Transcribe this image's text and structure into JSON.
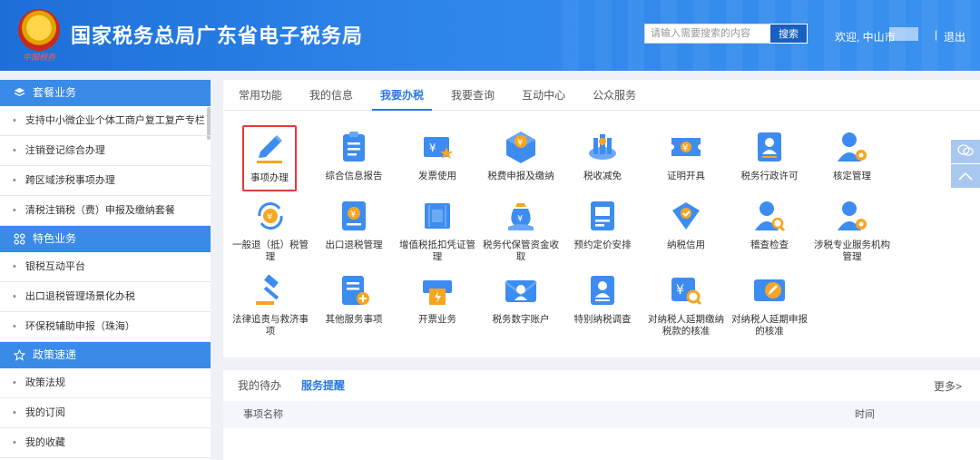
{
  "header": {
    "emblem_caption": "中国税务",
    "title": "国家税务总局广东省电子税务局",
    "search_placeholder": "请输入需要搜索的内容",
    "search_button": "搜索",
    "welcome": "欢迎, 中山市",
    "separator": "|",
    "logout": "退出"
  },
  "sidebar": {
    "sections": [
      {
        "title": "套餐业务",
        "icon": "layers-icon",
        "items": [
          "支持中小微企业个体工商户复工复产专栏",
          "注销登记综合办理",
          "跨区域涉税事项办理",
          "清税注销税（费）申报及缴纳套餐"
        ]
      },
      {
        "title": "特色业务",
        "icon": "grid-icon",
        "items": [
          "银税互动平台",
          "出口退税管理场景化办税",
          "环保税辅助申报（珠海）"
        ]
      },
      {
        "title": "政策速递",
        "icon": "star-icon",
        "items": [
          "政策法规",
          "我的订阅",
          "我的收藏"
        ]
      }
    ]
  },
  "main": {
    "tabs": [
      "常用功能",
      "我的信息",
      "我要办税",
      "我要查询",
      "互动中心",
      "公众服务"
    ],
    "active_tab": "我要办税",
    "tiles": [
      {
        "label": "事项办理",
        "icon": "pencil-icon"
      },
      {
        "label": "综合信息报告",
        "icon": "clipboard-icon"
      },
      {
        "label": "发票使用",
        "icon": "invoice-star-icon"
      },
      {
        "label": "税费申报及缴纳",
        "icon": "yuan-cube-icon"
      },
      {
        "label": "税收减免",
        "icon": "coins-icon"
      },
      {
        "label": "证明开具",
        "icon": "ticket-icon"
      },
      {
        "label": "税务行政许可",
        "icon": "id-card-icon"
      },
      {
        "label": "核定管理",
        "icon": "user-gear-icon"
      },
      {
        "label": "一般退（抵）税管理",
        "icon": "yuan-refresh-icon"
      },
      {
        "label": "出口退税管理",
        "icon": "yuan-document-icon"
      },
      {
        "label": "增值税抵扣凭证管理",
        "icon": "vat-receipt-icon"
      },
      {
        "label": "税务代保管资金收取",
        "icon": "money-bag-icon"
      },
      {
        "label": "预约定价安排",
        "icon": "document-list-icon"
      },
      {
        "label": "纳税信用",
        "icon": "shield-check-icon"
      },
      {
        "label": "稽查检查",
        "icon": "user-search-icon"
      },
      {
        "label": "涉税专业服务机构管理",
        "icon": "user-gear-icon"
      },
      {
        "label": "法律追责与救济事项",
        "icon": "gavel-icon"
      },
      {
        "label": "其他服务事项",
        "icon": "doc-add-icon"
      },
      {
        "label": "开票业务",
        "icon": "print-icon"
      },
      {
        "label": "税务数字账户",
        "icon": "mail-account-icon"
      },
      {
        "label": "特别纳税调查",
        "icon": "person-file-icon"
      },
      {
        "label": "对纳税人延期缴纳税款的核准",
        "icon": "yuan-search-icon"
      },
      {
        "label": "对纳税人延期申报的核准",
        "icon": "edit-card-icon"
      }
    ]
  },
  "bottom": {
    "tabs": [
      "我的待办",
      "服务提醒"
    ],
    "active_tab": "服务提醒",
    "more": "更多>",
    "col_name": "事项名称",
    "col_time": "时间"
  },
  "colors": {
    "primary": "#2a78e4",
    "header": "#2f86ea",
    "highlight": "#e53935",
    "icon_blue": "#3d8cf0",
    "icon_orange": "#f5a623"
  }
}
